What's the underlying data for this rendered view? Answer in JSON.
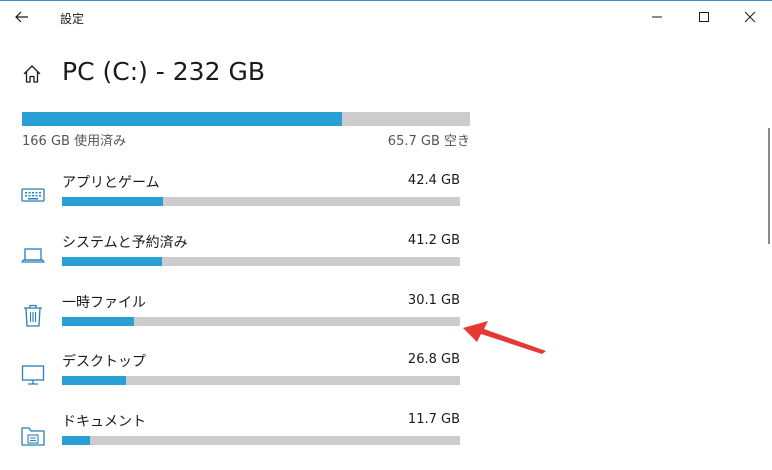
{
  "window": {
    "title": "設定",
    "back_icon": "back-arrow-icon",
    "minimize_icon": "minimize-icon",
    "maximize_icon": "maximize-icon",
    "close_icon": "close-icon"
  },
  "page": {
    "home_icon": "home-icon",
    "title": "PC (C:) - 232 GB"
  },
  "storage": {
    "used_label": "166 GB 使用済み",
    "free_label": "65.7 GB 空き",
    "used_fraction": 0.715
  },
  "categories": [
    {
      "icon": "keyboard-icon",
      "label": "アプリとゲーム",
      "size": "42.4 GB",
      "fraction": 0.255,
      "color": "#2a9fd6"
    },
    {
      "icon": "laptop-icon",
      "label": "システムと予約済み",
      "size": "41.2 GB",
      "fraction": 0.25,
      "color": "#2a9fd6"
    },
    {
      "icon": "trash-icon",
      "label": "一時ファイル",
      "size": "30.1 GB",
      "fraction": 0.182,
      "color": "#2a9fd6"
    },
    {
      "icon": "monitor-icon",
      "label": "デスクトップ",
      "size": "26.8 GB",
      "fraction": 0.161,
      "color": "#2a9fd6"
    },
    {
      "icon": "documents-icon",
      "label": "ドキュメント",
      "size": "11.7 GB",
      "fraction": 0.07,
      "color": "#2a9fd6"
    }
  ],
  "annotation": {
    "arrow_color": "#e53935"
  }
}
